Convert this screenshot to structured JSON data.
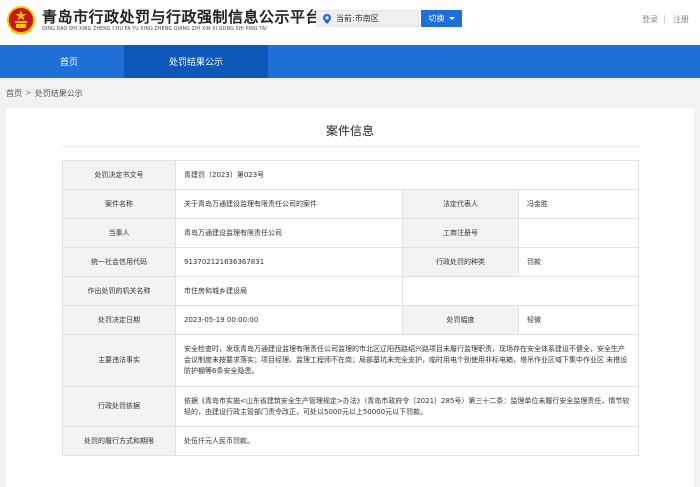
{
  "header": {
    "title": "青岛市行政处罚与行政强制信息公示平台",
    "subtitle": "QING DAO SHI XING ZHENG CHU FA YU XING ZHENG QIANG ZHI XIN XI GONG SHI PING TAI",
    "location_text": "当前:市南区",
    "switch_label": "切换",
    "login_label": "登录",
    "separator": "|",
    "register_label": "注册"
  },
  "nav": {
    "items": [
      {
        "label": "首页",
        "active": false
      },
      {
        "label": "处罚结果公示",
        "active": true
      }
    ]
  },
  "breadcrumb": {
    "home": "首页",
    "separator": ">",
    "current": "处罚结果公示"
  },
  "card": {
    "title": "案件信息",
    "rows": {
      "decision_no_label": "处罚决定书文号",
      "decision_no": "青建罚〔2023〕第023号",
      "case_name_label": "案件名称",
      "case_name": "关于青岛万通建设监理有限责任公司的案件",
      "legal_rep_label": "法定代表人",
      "legal_rep": "冯金胜",
      "party_label": "当事人",
      "party": "青岛万通建设监理有限责任公司",
      "biz_reg_label": "工商注册号",
      "biz_reg": "",
      "credit_code_label": "统一社会信用代码",
      "credit_code": "913702121636367831",
      "penalty_type_label": "行政处罚的种类",
      "penalty_type": "罚款",
      "authority_label": "作出处罚的机关名称",
      "authority": "市住房和城乡建设局",
      "decision_date_label": "处罚决定日期",
      "decision_date": "2023-05-19 00:00:00",
      "penalty_range_label": "处罚幅度",
      "penalty_range": "轻微",
      "violation_label": "主要违法事实",
      "violation": "安全检查时，发现青岛万通建设监理有限责任公司监理的市北区辽阳西路绍兴路项目未履行监理职责，现场存在安全体系建设不健全，安全生产会议制度未按要求落实；项目经理、监理工程师不在岗；局部基坑未完全支护，临时用电个别使用非标电箱，塔吊作业区域下集中作业区 未搭设防护棚等6条安全隐患。",
      "basis_label": "行政处罚依据",
      "basis": "依据《青岛市实施<山东省建筑安全生产管理规定>办法》（青岛市政府令〔2021〕285号）第三十二条：监理单位未履行安全监理责任，情节较轻的，由建设行政主管部门责令改正，可处以5000元以上50000元以下罚款。",
      "performance_label": "处罚的履行方式和期限",
      "performance": "处伍仟元人民币罚款。"
    }
  },
  "colors": {
    "brand_blue": "#1f6fd8",
    "active_nav": "#0e58b9",
    "emblem_red": "#c8161d",
    "emblem_gold": "#f2c700"
  },
  "icons": {
    "emblem": "national-emblem",
    "location": "map-pin-icon",
    "switch_caret": "caret-down-icon"
  }
}
